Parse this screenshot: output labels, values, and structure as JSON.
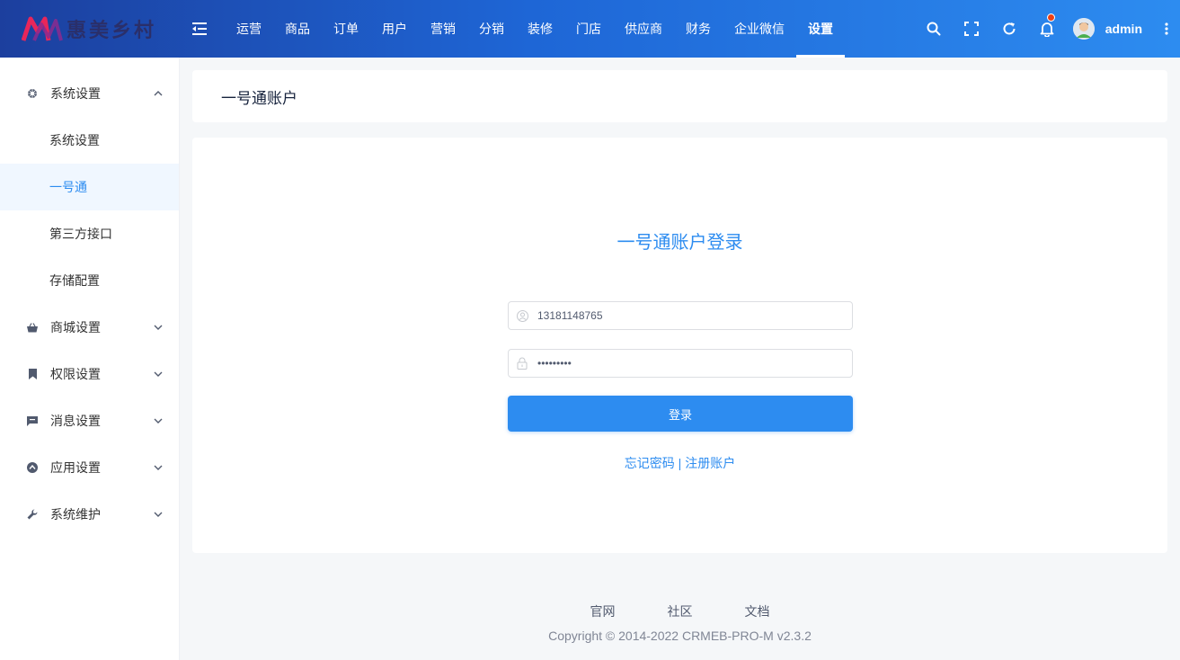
{
  "header": {
    "logo_text": "惠美乡村",
    "nav": [
      "运营",
      "商品",
      "订单",
      "用户",
      "营销",
      "分销",
      "装修",
      "门店",
      "供应商",
      "财务",
      "企业微信",
      "设置"
    ],
    "active_nav": "设置",
    "username": "admin",
    "gradient": [
      "#1c3f9e",
      "#2d8cf0"
    ],
    "notification_dot_color": "#ed4014"
  },
  "sidebar": {
    "groups": [
      {
        "label": "系统设置",
        "icon": "gear-icon",
        "expanded": true,
        "items": [
          "系统设置",
          "一号通",
          "第三方接口",
          "存储配置"
        ],
        "active_item": "一号通"
      },
      {
        "label": "商城设置",
        "icon": "basket-icon",
        "expanded": false
      },
      {
        "label": "权限设置",
        "icon": "bookmark-icon",
        "expanded": false
      },
      {
        "label": "消息设置",
        "icon": "message-icon",
        "expanded": false
      },
      {
        "label": "应用设置",
        "icon": "app-icon",
        "expanded": false
      },
      {
        "label": "系统维护",
        "icon": "wrench-icon",
        "expanded": false
      }
    ]
  },
  "page": {
    "title": "一号通账户"
  },
  "login": {
    "title": "一号通账户登录",
    "phone_value": "13181148765",
    "password_value": "•••••••••",
    "button_label": "登录",
    "forgot_label": "忘记密码",
    "separator": " | ",
    "register_label": "注册账户",
    "accent": "#2d8cf0"
  },
  "footer": {
    "links": [
      "官网",
      "社区",
      "文档"
    ],
    "copyright": "Copyright © 2014-2022 CRMEB-PRO-M v2.3.2"
  }
}
